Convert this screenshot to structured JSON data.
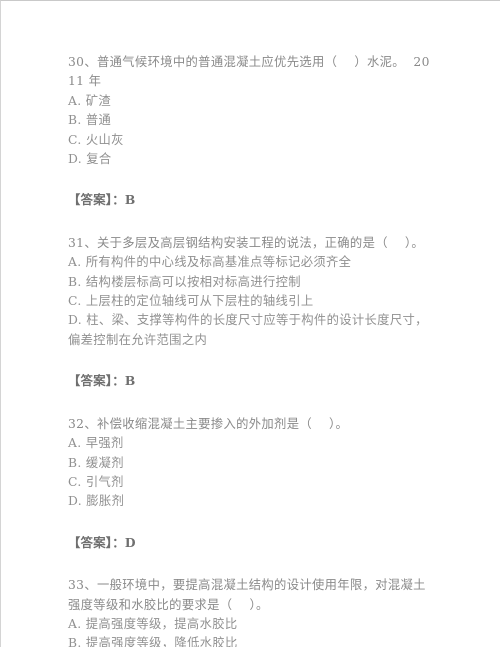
{
  "document": {
    "type": "exam-question-sheet",
    "language": "zh-CN",
    "background_color": "#ffffff",
    "text_color": "#8e8e8e",
    "answer_label": "【答案】："
  },
  "questions": [
    {
      "number": "30",
      "stem": "30、普通气候环境中的普通混凝土应优先选用（    ）水泥。  2011 年",
      "options": [
        "A. 矿渣",
        "B. 普通",
        "C. 火山灰",
        "D. 复合"
      ],
      "answer": "【答案】：B"
    },
    {
      "number": "31",
      "stem": "31、关于多层及高层钢结构安装工程的说法，正确的是（    ）。",
      "options": [
        "A. 所有构件的中心线及标高基准点等标记必须齐全",
        "B. 结构楼层标高可以按相对标高进行控制",
        "C. 上层柱的定位轴线可从下层柱的轴线引上",
        "D. 柱、梁、支撑等构件的长度尺寸应等于构件的设计长度尺寸，偏差控制在允许范围之内"
      ],
      "answer": "【答案】：B"
    },
    {
      "number": "32",
      "stem": "32、补偿收缩混凝土主要掺入的外加剂是（    ）。",
      "options": [
        "A. 早强剂",
        "B. 缓凝剂",
        "C. 引气剂",
        "D. 膨胀剂"
      ],
      "answer": "【答案】：D"
    },
    {
      "number": "33",
      "stem": "33、一般环境中，要提高混凝土结构的设计使用年限，对混凝土强度等级和水胶比的要求是（    ）。",
      "options": [
        "A. 提高强度等级，提高水胶比",
        "B. 提高强度等级，降低水胶比"
      ],
      "answer": null
    }
  ]
}
